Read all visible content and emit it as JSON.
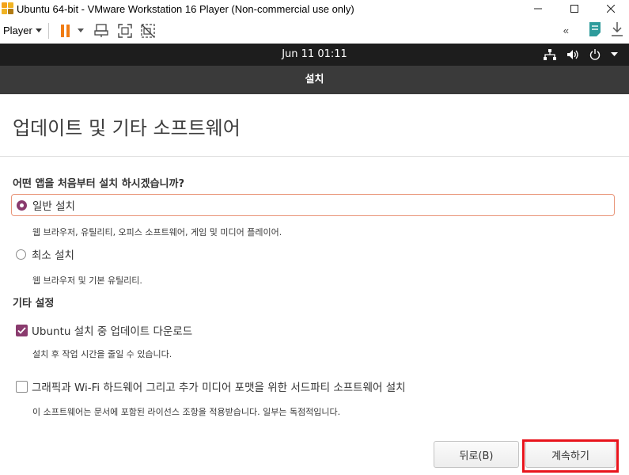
{
  "window": {
    "title": "Ubuntu 64-bit - VMware Workstation 16 Player (Non-commercial use only)",
    "minimize_icon": "minimize-icon",
    "maximize_icon": "maximize-icon",
    "close_icon": "close-icon"
  },
  "toolbar": {
    "player_label": "Player",
    "icons": [
      "pause-icon",
      "send-ctrl-alt-del-icon",
      "fullscreen-icon",
      "unity-icon",
      "collapse-icon",
      "notes-icon",
      "download-icon"
    ]
  },
  "topbar": {
    "datetime": "Jun 11  01:11",
    "icons": [
      "network-icon",
      "volume-icon",
      "power-icon",
      "chevron-down-icon"
    ]
  },
  "installer": {
    "header_title": "설치",
    "page_title": "업데이트 및 기타 소프트웨어",
    "question": "어떤 앱을 처음부터 설치 하시겠습니까?",
    "options": [
      {
        "label": "일반 설치",
        "desc": "웹 브라우저, 유틸리티, 오피스  소프트웨어, 게임 및 미디어 플레이어.",
        "selected": true
      },
      {
        "label": "최소 설치",
        "desc": "웹 브라우저 및 기본 유틸리티.",
        "selected": false
      }
    ],
    "other_section": "기타 설정",
    "checkboxes": [
      {
        "label": "Ubuntu 설치 중 업데이트 다운로드",
        "desc": "설치 후 작업 시간을 줄일 수 있습니다.",
        "checked": true
      },
      {
        "label": "그래픽과 Wi-Fi 하드웨어 그리고 추가 미디어 포맷을 위한 서드파티 소프트웨어 설치",
        "desc": "이 소프트웨어는 문서에 포함된 라이선스 조항을 적용받습니다. 일부는 독점적입니다.",
        "checked": false
      }
    ],
    "back_button": "뒤로(B)",
    "continue_button": "계속하기"
  },
  "colors": {
    "accent": "#8a3b6e",
    "focus_border": "#e9967a",
    "highlight": "#e8141c",
    "topbar": "#1d1d1d",
    "header": "#3a3a3a"
  }
}
